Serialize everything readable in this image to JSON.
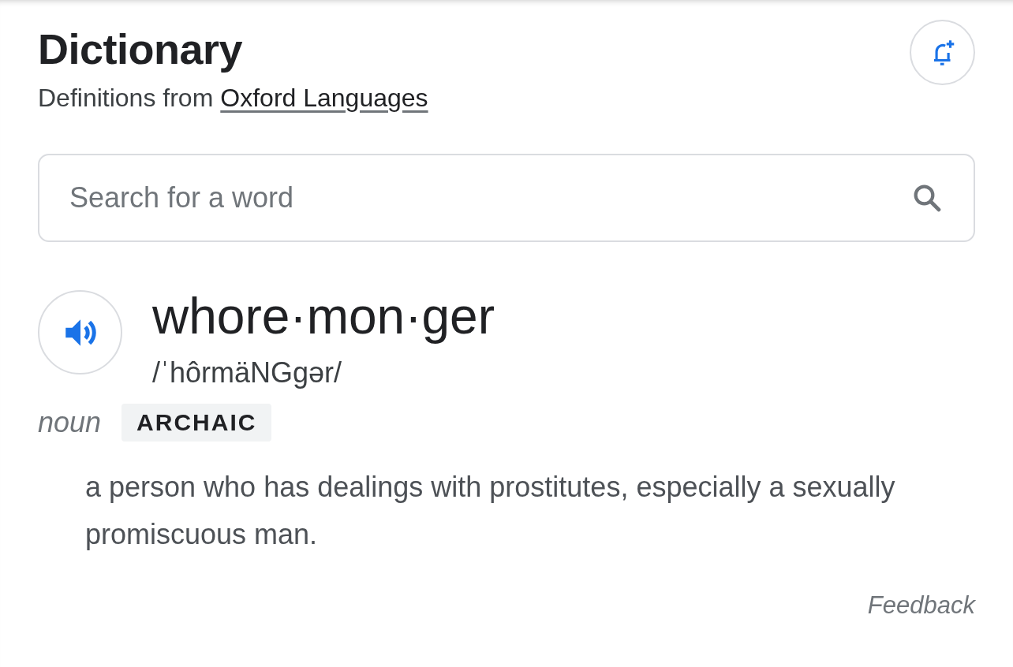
{
  "header": {
    "title": "Dictionary",
    "source_prefix": "Definitions from",
    "source_link": "Oxford Languages"
  },
  "search": {
    "placeholder": "Search for a word"
  },
  "entry": {
    "word": "whore·mon·ger",
    "pronunciation": "/ˈhôrmäNGgər/",
    "senses": [
      {
        "part_of_speech": "noun",
        "label": "ARCHAIC",
        "definition": "a person who has dealings with prostitutes, especially a sexually promiscuous man."
      }
    ]
  },
  "footer": {
    "feedback": "Feedback"
  }
}
